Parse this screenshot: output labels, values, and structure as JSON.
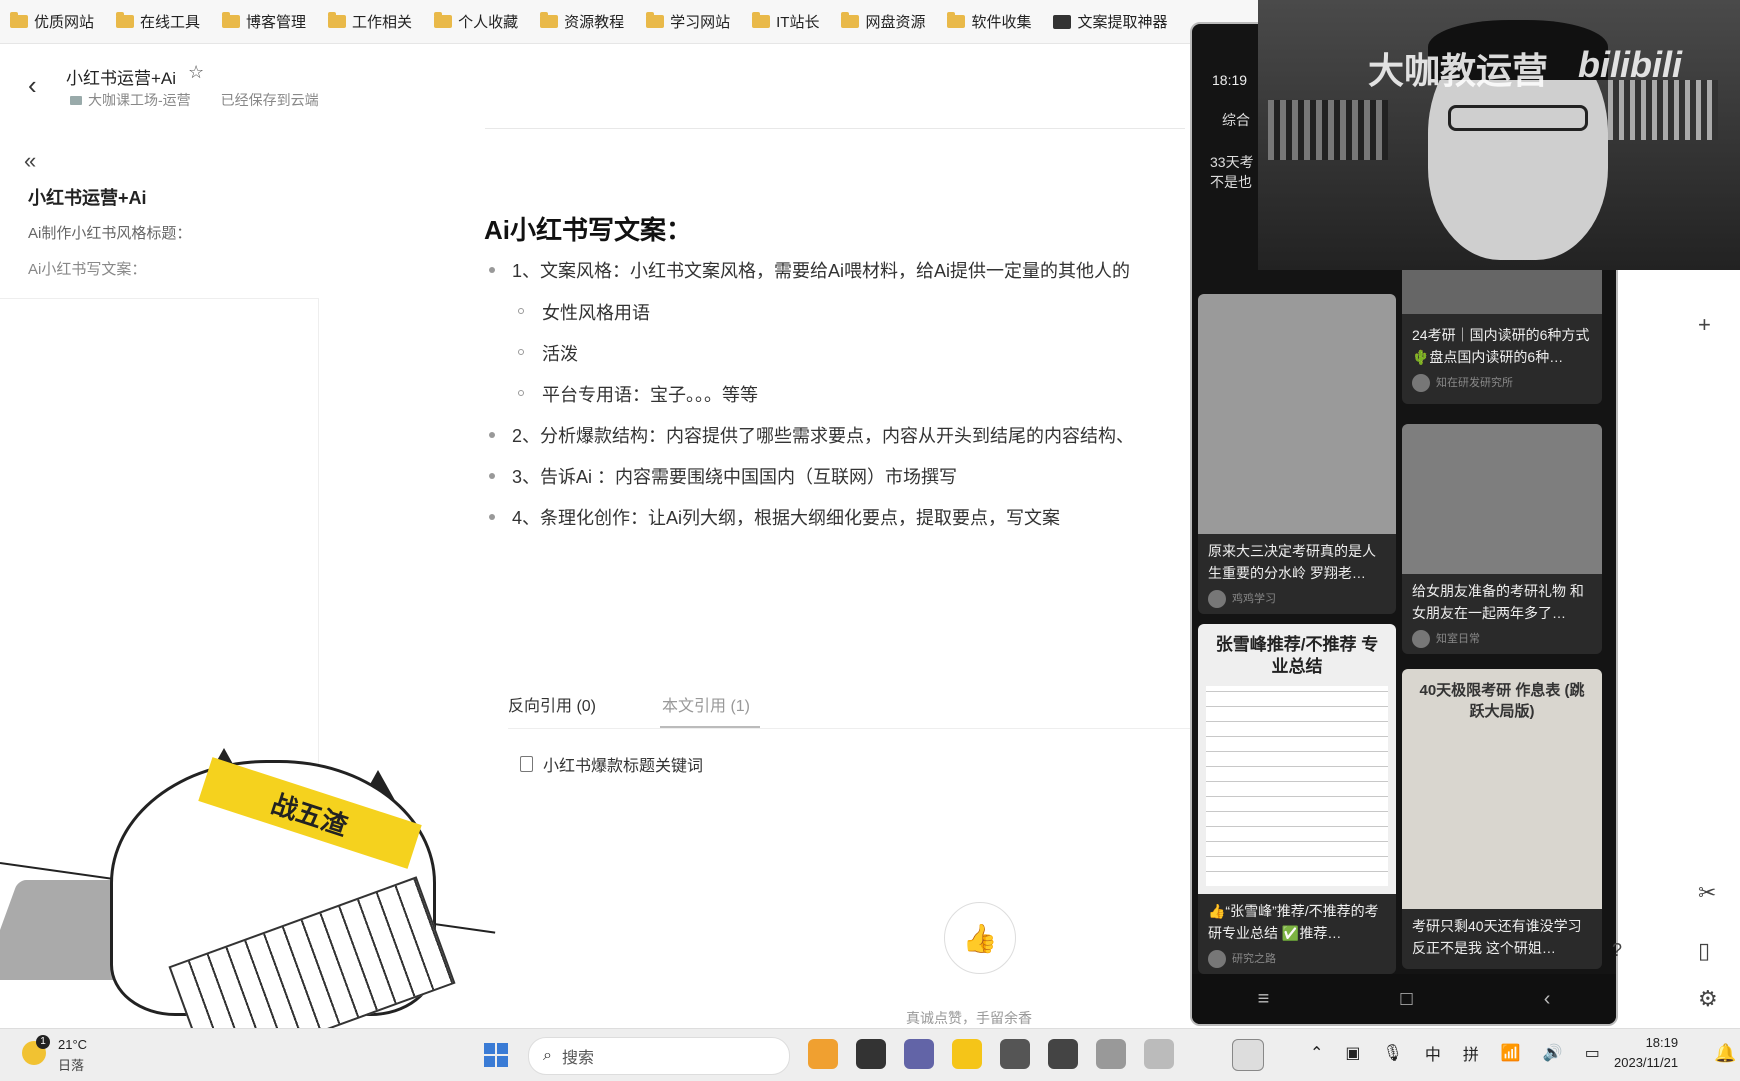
{
  "bookmarks": [
    {
      "label": "优质网站",
      "icon": "folder-icon"
    },
    {
      "label": "在线工具",
      "icon": "folder-icon"
    },
    {
      "label": "博客管理",
      "icon": "folder-icon"
    },
    {
      "label": "工作相关",
      "icon": "folder-icon"
    },
    {
      "label": "个人收藏",
      "icon": "folder-icon"
    },
    {
      "label": "资源教程",
      "icon": "folder-icon"
    },
    {
      "label": "学习网站",
      "icon": "folder-icon"
    },
    {
      "label": "IT站长",
      "icon": "folder-icon"
    },
    {
      "label": "网盘资源",
      "icon": "folder-icon"
    },
    {
      "label": "软件收集",
      "icon": "folder-icon"
    },
    {
      "label": "文案提取神器",
      "icon": "app-icon"
    }
  ],
  "header": {
    "title": "小红书运营+Ai",
    "breadcrumb_folder": "大咖课工场-运营",
    "saved_status": "已经保存到云端"
  },
  "sidebar": {
    "outline_title": "小红书运营+Ai",
    "items": [
      "Ai制作小红书风格标题：",
      "Ai小红书写文案："
    ]
  },
  "doc": {
    "heading": "Ai小红书写文案：",
    "items": [
      {
        "text": "1、文案风格：小红书文案风格，需要给Ai喂材料，给Ai提供一定量的其他人的",
        "level": 1
      },
      {
        "text": "女性风格用语",
        "level": 2
      },
      {
        "text": "活泼",
        "level": 2
      },
      {
        "text": "平台专用语：宝子。。。等等",
        "level": 2
      },
      {
        "text": "2、分析爆款结构：内容提供了哪些需求要点，内容从开头到结尾的内容结构、",
        "level": 1
      },
      {
        "text": "3、告诉Ai ：内容需要围绕中国国内（互联网）市场撰写",
        "level": 1
      },
      {
        "text": "4、条理化创作：让Ai列大纲，根据大纲细化要点，提取要点，写文案",
        "level": 1
      }
    ],
    "refs_tab_back": "反向引用 (0)",
    "refs_tab_inline": "本文引用 (1)",
    "ref_item": "小红书爆款标题关键词",
    "like_text": "真诚点赞，手留余香"
  },
  "phone": {
    "time": "18:19",
    "tab": "综合",
    "snippet": "33天考\n不是也",
    "cards": [
      {
        "title": "24考研｜国内读研的6种方式 🌵盘点国内读研的6种…",
        "meta": "知在研发研究所"
      },
      {
        "title": "原来大三决定考研真的是人生重要的分水岭 罗翔老…",
        "meta": "鸡鸡学习"
      },
      {
        "title": "给女朋友准备的考研礼物 和女朋友在一起两年多了…",
        "meta": "知室日常"
      },
      {
        "title": "👍“张雪峰”推荐/不推荐的考研专业总结 ✅推荐…",
        "meta": "研究之路"
      },
      {
        "title": "考研只剩40天还有谁没学习 反正不是我 这个研姐…",
        "meta": ""
      }
    ],
    "poster_title": "张雪峰推荐/不推荐 专业总结",
    "poster_right": "40天极限考研 作息表 (跳跃大局版)"
  },
  "webcam": {
    "watermark": "大咖教运营",
    "brand": "bilibili"
  },
  "sticker": {
    "headband_text": "战五渣"
  },
  "taskbar": {
    "temperature": "21°C",
    "weather": "日落",
    "weather_badge": "1",
    "search_placeholder": "搜索",
    "ime_lang": "中",
    "ime_mode": "拼",
    "time": "18:19",
    "date": "2023/11/21"
  }
}
